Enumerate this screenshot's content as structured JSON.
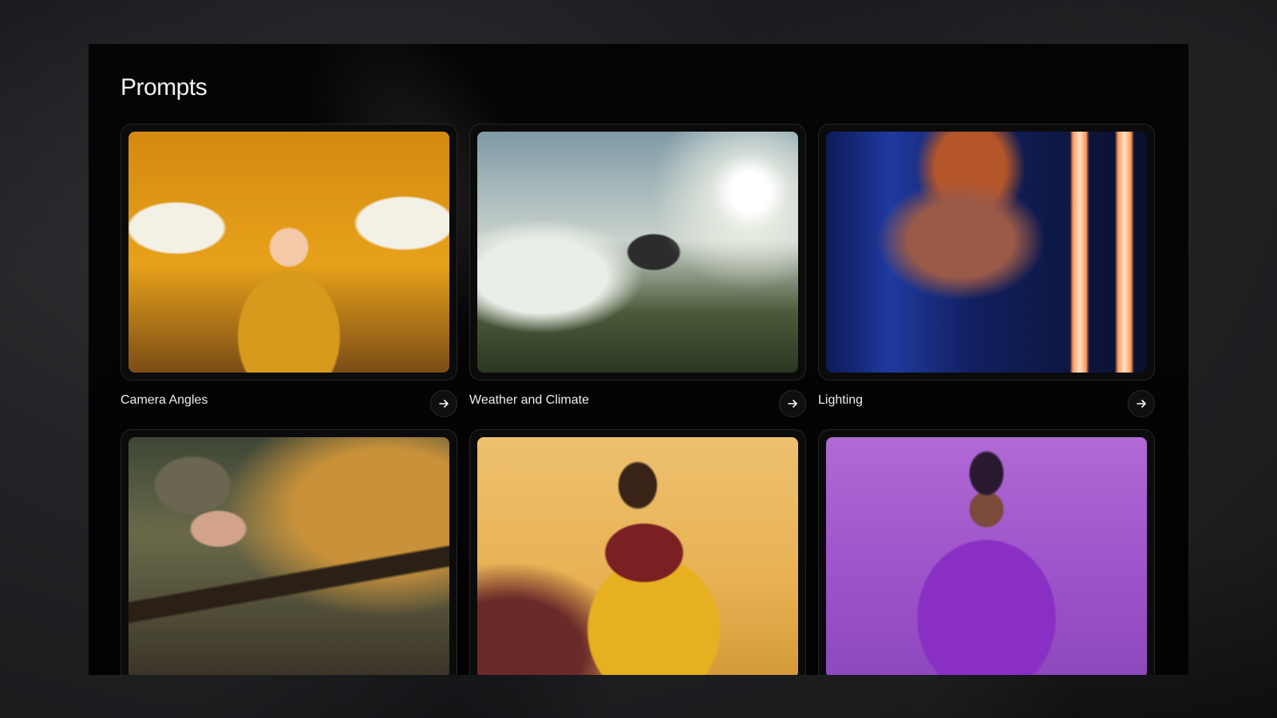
{
  "page": {
    "title": "Prompts"
  },
  "cards": [
    {
      "label": "Camera Angles",
      "image": "fisheye-portrait-image",
      "colors": [
        "#c98a12",
        "#f0a91c",
        "#6b4a10"
      ]
    },
    {
      "label": "Weather and Climate",
      "image": "runner-mountain-image",
      "colors": [
        "#8aa7b0",
        "#dfe2d8",
        "#3b4a30"
      ]
    },
    {
      "label": "Lighting",
      "image": "neon-portrait-image",
      "colors": [
        "#1a2a6e",
        "#c06a3a",
        "#0b1230"
      ]
    },
    {
      "label": "",
      "image": "soldier-rifle-image",
      "colors": [
        "#4c4a38",
        "#b98a3a",
        "#2a2820"
      ]
    },
    {
      "label": "",
      "image": "yellow-outfit-image",
      "colors": [
        "#e7b24e",
        "#f2c56a",
        "#7a2a22"
      ]
    },
    {
      "label": "",
      "image": "purple-outfit-image",
      "colors": [
        "#9a45c4",
        "#b56ad8",
        "#6a2a9a"
      ]
    }
  ],
  "icons": {
    "card_action": "arrow-right-icon"
  }
}
